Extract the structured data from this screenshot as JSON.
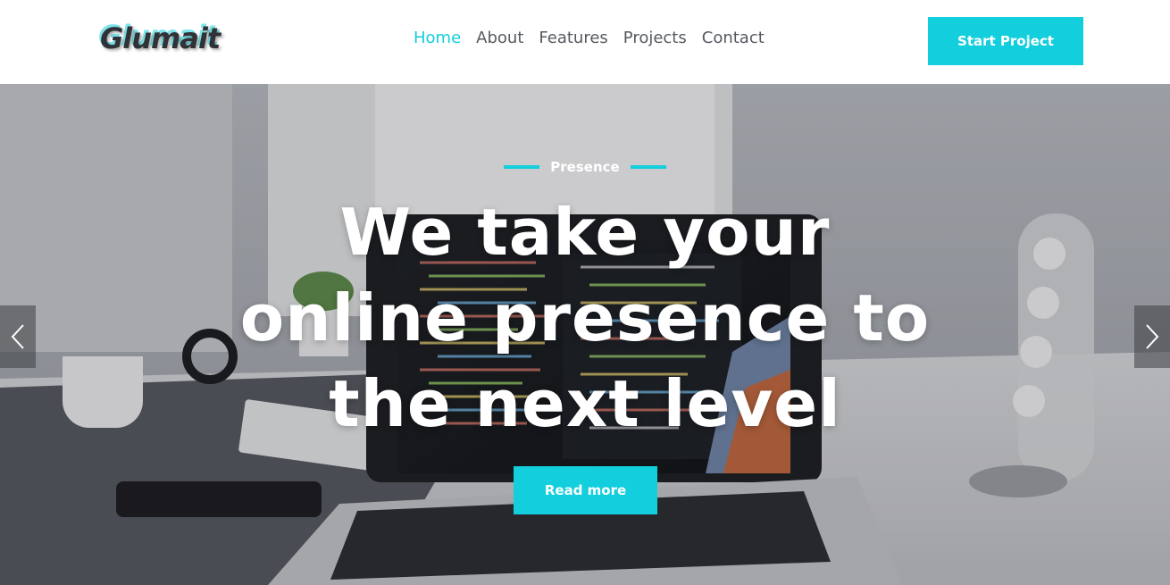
{
  "brand": {
    "logo_text": "Glumait",
    "accent_color": "#13cedc"
  },
  "nav": {
    "items": [
      {
        "label": "Home",
        "active": true
      },
      {
        "label": "About",
        "active": false
      },
      {
        "label": "Features",
        "active": false
      },
      {
        "label": "Projects",
        "active": false
      },
      {
        "label": "Contact",
        "active": false
      }
    ],
    "cta_label": "Start Project"
  },
  "hero": {
    "eyebrow": "Presence",
    "headline_lines": [
      "We take your",
      "online presence to",
      "the next level"
    ],
    "button_label": "Read more",
    "prev_icon": "chevron-left-icon",
    "next_icon": "chevron-right-icon"
  }
}
